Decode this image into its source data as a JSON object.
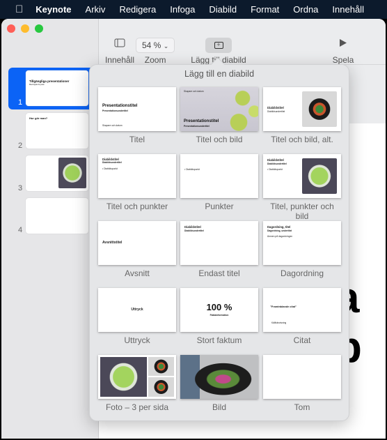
{
  "menubar": {
    "items": [
      "Keynote",
      "Arkiv",
      "Redigera",
      "Infoga",
      "Diabild",
      "Format",
      "Ordna",
      "Innehåll"
    ]
  },
  "toolbar": {
    "content_label": "Innehåll",
    "zoom_value": "54 %",
    "zoom_label": "Zoom",
    "add_slide_label": "Lägg till diabild",
    "play_label": "Spela"
  },
  "slides": [
    {
      "num": "1",
      "title": "Tillgängliga presentationer",
      "subtitle": "Med Apple Keynote",
      "selected": true
    },
    {
      "num": "2",
      "title": "Hur gör man?"
    },
    {
      "num": "3",
      "title": ""
    },
    {
      "num": "4",
      "title": ""
    }
  ],
  "canvas_text": "a p",
  "popover": {
    "title": "Lägg till en diabild",
    "layouts": [
      {
        "label": "Titel",
        "type": "title",
        "t1": "Presentationstitel",
        "t2": "Presentationsundertitel",
        "t3": "Skapare och datum"
      },
      {
        "label": "Titel och bild",
        "type": "title-photo",
        "t1": "Presentationstitel",
        "t2": "Presentationsundertitel",
        "t3": "Skapare och datum"
      },
      {
        "label": "Titel och bild, alt.",
        "type": "title-photo-alt",
        "t1": "Diabildstitel",
        "t2": "Diabildsundertitel"
      },
      {
        "label": "Titel och punkter",
        "type": "title-bullets",
        "t1": "Diabildstitel",
        "t2": "Diabildsundertitel",
        "t3": "• Diabildspunkt"
      },
      {
        "label": "Punkter",
        "type": "bullets",
        "t3": "• Diabildspunkt"
      },
      {
        "label": "Titel, punkter och bild",
        "type": "title-bullets-photo",
        "t1": "Diabildstitel",
        "t2": "Diabildsundertitel",
        "t3": "• Diabildspunkt"
      },
      {
        "label": "Avsnitt",
        "type": "section",
        "t1": "Avsnittstitel"
      },
      {
        "label": "Endast titel",
        "type": "title-only",
        "t1": "Diabildstitel",
        "t2": "Diabildsundertitel"
      },
      {
        "label": "Dagordning",
        "type": "agenda",
        "t1": "Dagordning, titel",
        "t2": "Dagordning, undertitel",
        "t3": "Ämnen på dagordningen"
      },
      {
        "label": "Uttryck",
        "type": "statement",
        "t1": "Uttryck"
      },
      {
        "label": "Stort faktum",
        "type": "fact",
        "t1": "100 %",
        "t2": "Faktainformation"
      },
      {
        "label": "Citat",
        "type": "quote",
        "t1": "”Framträdande citat”",
        "t2": "Källhänvisning"
      },
      {
        "label": "Foto – 3 per sida",
        "type": "photo-3"
      },
      {
        "label": "Bild",
        "type": "photo"
      },
      {
        "label": "Tom",
        "type": "blank"
      }
    ]
  },
  "colors": {
    "menubar": "#0c1a2c",
    "selection": "#0b63f6",
    "close": "#ff5f57",
    "minimize": "#febc2e",
    "zoom": "#28c840"
  }
}
